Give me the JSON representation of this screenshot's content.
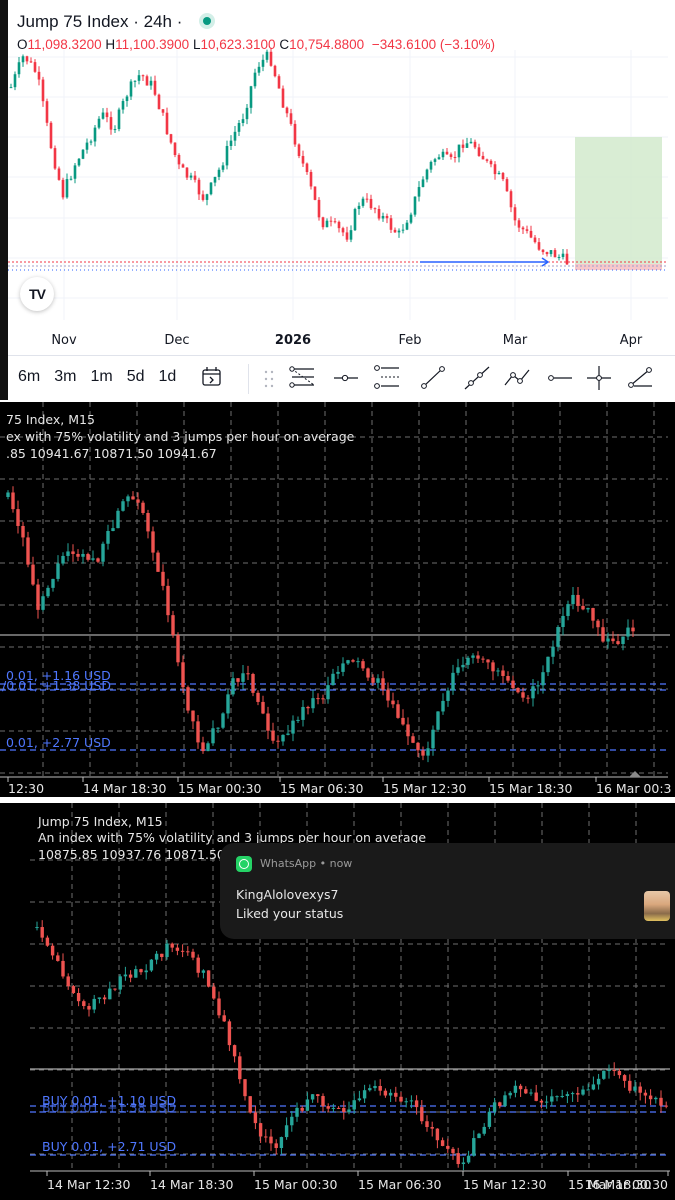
{
  "colors": {
    "up": "#26a69a",
    "down": "#ef5350",
    "tv_up": "#089981",
    "tv_down": "#f23645",
    "mt_text": "#e6e6e6",
    "mt_order": "#4f77ff",
    "mt_grid": "#6e6e6e"
  },
  "tradingview": {
    "symbol": "Jump 75 Index · 24h ·",
    "ohlc": {
      "o_label": "O",
      "o": "11,098.3200",
      "h_label": "H",
      "h": "11,100.3900",
      "l_label": "L",
      "l": "10,623.3100",
      "c_label": "C",
      "c": "10,754.8800",
      "change": "−343.6100 (−3.10%)"
    },
    "logo": "TV",
    "x_labels": [
      "Nov",
      "Dec",
      "2026",
      "Feb",
      "Mar",
      "Apr"
    ],
    "timeframes": [
      "6m",
      "3m",
      "1m",
      "5d",
      "1d"
    ],
    "tool_icons": [
      "calendar-range-icon",
      "drag-handle-icon",
      "fib-retracement-icon",
      "horizontal-ray-icon",
      "parallel-channel-icon",
      "trend-line-icon",
      "ray-icon",
      "path-icon",
      "horizontal-line-icon",
      "crosshair-icon",
      "info-line-icon"
    ],
    "series": {
      "trend": [
        10800,
        10920,
        10850,
        10600,
        10400,
        10520,
        10600,
        10700,
        10650,
        10780,
        10850,
        10800,
        10650,
        10500,
        10450,
        10380,
        10480,
        10600,
        10700,
        10880,
        10920,
        10750,
        10600,
        10450,
        10300,
        10280,
        10250,
        10380,
        10360,
        10300,
        10250,
        10350,
        10480,
        10550,
        10520,
        10600,
        10580,
        10500,
        10450,
        10300,
        10250,
        10200,
        10180,
        10150
      ]
    }
  },
  "mt_top": {
    "title": "75 Index, M15",
    "description": "ex with 75% volatility and 3 jumps per hour on average",
    "prices": ".85 10941.67 10871.50 10941.67",
    "orders": [
      {
        "label": "0.01,  +1.16 USD"
      },
      {
        "label": "/0.01,  +1.38 USD"
      },
      {
        "label": "0.01,  +2.77 USD"
      }
    ],
    "time_labels": [
      "12:30",
      "14 Mar 18:30",
      "15 Mar 00:30",
      "15 Mar 06:30",
      "15 Mar 12:30",
      "15 Mar 18:30",
      "16 Mar 00:3"
    ],
    "series": {
      "trend": [
        10940,
        10880,
        10790,
        10830,
        10870,
        10860,
        10850,
        10900,
        10940,
        10920,
        10850,
        10760,
        10650,
        10590,
        10620,
        10680,
        10700,
        10640,
        10600,
        10620,
        10650,
        10660,
        10700,
        10720,
        10700,
        10680,
        10650,
        10600,
        10580,
        10650,
        10700,
        10720,
        10710,
        10700,
        10680,
        10660,
        10700,
        10760,
        10800,
        10780,
        10740,
        10740,
        10760
      ]
    }
  },
  "mt_bottom": {
    "title": "Jump 75 Index, M15",
    "description": "An index with 75% volatility and 3 jumps per hour on average",
    "prices": "10875.85 10937.76 10871.50",
    "orders": [
      {
        "label": "BUY 0.01,  +1.10 USD"
      },
      {
        "label": "BUY 0.01,  +1.38 USD"
      },
      {
        "label": "BUY 0.01,  +2.71 USD"
      }
    ],
    "time_labels": [
      "14 Mar 12:30",
      "14 Mar 18:30",
      "15 Mar 00:30",
      "15 Mar 06:30",
      "15 Mar 12:30",
      "15 Mar 18:30",
      "16 Mar 00:30"
    ],
    "series": {
      "trend": [
        10920,
        10880,
        10840,
        10810,
        10830,
        10850,
        10860,
        10880,
        10900,
        10880,
        10850,
        10790,
        10710,
        10640,
        10620,
        10660,
        10690,
        10680,
        10670,
        10690,
        10700,
        10690,
        10680,
        10650,
        10620,
        10600,
        10640,
        10680,
        10700,
        10690,
        10680,
        10700,
        10690,
        10720,
        10730,
        10700,
        10690,
        10680
      ]
    }
  },
  "notification": {
    "app": "WhatsApp • now",
    "sender": "KingAlolovexys7",
    "message": "Liked your status"
  }
}
